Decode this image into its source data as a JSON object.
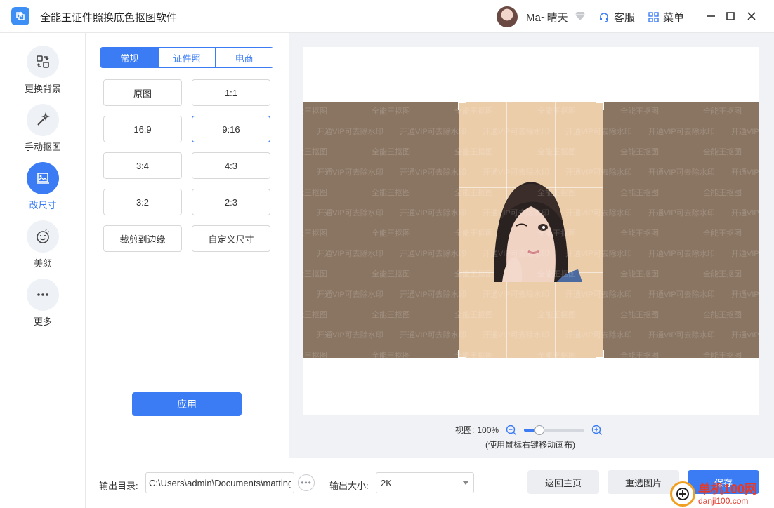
{
  "titlebar": {
    "app_title": "全能王证件照换底色抠图软件",
    "username": "Ma~晴天",
    "service_label": "客服",
    "menu_label": "菜单"
  },
  "nav": {
    "items": [
      {
        "label": "更换背景",
        "icon": "swap-icon"
      },
      {
        "label": "手动抠图",
        "icon": "magic-wand-icon"
      },
      {
        "label": "改尺寸",
        "icon": "crop-image-icon",
        "active": true
      },
      {
        "label": "美颜",
        "icon": "smile-icon"
      },
      {
        "label": "更多",
        "icon": "more-icon"
      }
    ]
  },
  "panel": {
    "tabs": [
      {
        "label": "常规",
        "active": true
      },
      {
        "label": "证件照"
      },
      {
        "label": "电商"
      }
    ],
    "ratios": [
      "原图",
      "1:1",
      "16:9",
      "9:16",
      "3:4",
      "4:3",
      "3:2",
      "2:3",
      "裁剪到边缘",
      "自定义尺寸"
    ],
    "selected_ratio": "9:16",
    "apply_label": "应用"
  },
  "canvas": {
    "watermark_a": "全能王抠图",
    "watermark_b": "开通VIP可去除水印"
  },
  "zoom": {
    "label": "视图:",
    "value": "100%",
    "hint": "(使用鼠标右键移动画布)",
    "level_fraction": 0.2
  },
  "bottom": {
    "output_dir_label": "输出目录:",
    "output_dir_value": "C:\\Users\\admin\\Documents\\matting",
    "output_size_label": "输出大小:",
    "output_size_value": "2K",
    "home_label": "返回主页",
    "reselect_label": "重选图片",
    "save_label": "保存"
  },
  "site_watermark": {
    "cn": "单机100网",
    "en": "danji100.com"
  },
  "colors": {
    "accent": "#3b7cf5",
    "crop_bg": "#eccdaa",
    "outside_bg": "#8a7562"
  }
}
